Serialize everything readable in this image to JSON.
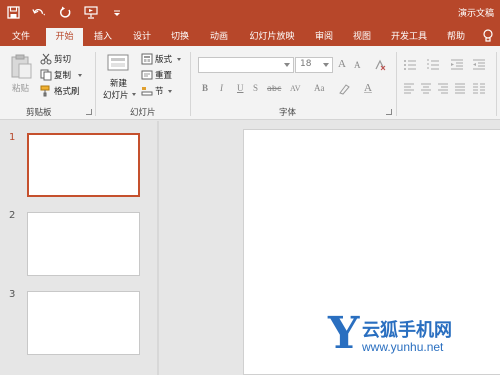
{
  "window": {
    "title": "演示文稿",
    "accent_color": "#b7472a"
  },
  "qat": {
    "icons": [
      "save-icon",
      "undo-icon",
      "redo-icon",
      "present-from-start-icon",
      "customize-qat-icon"
    ]
  },
  "tabs": [
    {
      "label": "文件",
      "active": false
    },
    {
      "label": "开始",
      "active": true
    },
    {
      "label": "插入",
      "active": false
    },
    {
      "label": "设计",
      "active": false
    },
    {
      "label": "切换",
      "active": false
    },
    {
      "label": "动画",
      "active": false
    },
    {
      "label": "幻灯片放映",
      "active": false
    },
    {
      "label": "审阅",
      "active": false
    },
    {
      "label": "视图",
      "active": false
    },
    {
      "label": "开发工具",
      "active": false
    },
    {
      "label": "帮助",
      "active": false
    }
  ],
  "ribbon": {
    "clipboard": {
      "paste": "粘贴",
      "cut": "剪切",
      "copy": "复制",
      "format_painter": "格式刷",
      "group_label": "剪贴板"
    },
    "slides": {
      "new_slide_line1": "新建",
      "new_slide_line2": "幻灯片",
      "layout": "版式",
      "reset": "重置",
      "section": "节",
      "group_label": "幻灯片"
    },
    "font": {
      "font_name": "",
      "font_size": "18",
      "group_label": "字体",
      "bold": "B",
      "italic": "I",
      "underline": "U",
      "shadow": "S",
      "strike": "abc",
      "spacing": "AV",
      "case": "Aa",
      "grow": "A",
      "shrink": "A",
      "color": "A"
    }
  },
  "slides": [
    {
      "number": "1",
      "selected": true
    },
    {
      "number": "2",
      "selected": false
    },
    {
      "number": "3",
      "selected": false
    }
  ],
  "watermark": {
    "letter": "Y",
    "name": "云狐手机网",
    "url": "www.yunhu.net"
  }
}
